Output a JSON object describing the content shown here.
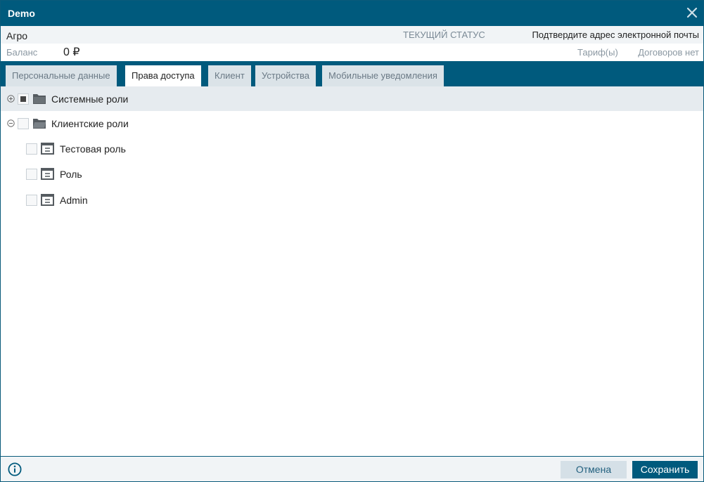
{
  "window": {
    "title": "Demo"
  },
  "info": {
    "name": "Агро",
    "status_label": "ТЕКУЩИЙ СТАТУС",
    "status_value": "Подтвердите адрес электронной почты",
    "balance_label": "Баланс",
    "balance_value": "0 ₽",
    "tariff": "Тариф(ы)",
    "contracts": "Договоров нет"
  },
  "tabs": [
    {
      "label": "Персональные данные",
      "active": false
    },
    {
      "label": "Права доступа",
      "active": true
    },
    {
      "label": "Клиент",
      "active": false
    },
    {
      "label": "Устройства",
      "active": false
    },
    {
      "label": "Мобильные уведомления",
      "active": false
    }
  ],
  "tree": {
    "system_roles": {
      "label": "Системные роли",
      "expanded": false,
      "checked": "partial"
    },
    "client_roles": {
      "label": "Клиентские роли",
      "expanded": true,
      "checked": false,
      "children": [
        {
          "label": "Тестовая роль",
          "checked": false
        },
        {
          "label": "Роль",
          "checked": false
        },
        {
          "label": "Admin",
          "checked": false
        }
      ]
    }
  },
  "footer": {
    "cancel_label": "Отмена",
    "save_label": "Сохранить"
  },
  "colors": {
    "primary": "#005a7d",
    "tab_inactive": "#dbe3e8",
    "row_highlight": "#e6ebef",
    "cancel_bg": "#d5e0e7"
  },
  "icons": {
    "close": "close-icon",
    "expand": "plus-circle-icon",
    "collapse": "minus-circle-icon",
    "folder": "folder-icon",
    "role": "role-icon",
    "info": "info-icon"
  }
}
